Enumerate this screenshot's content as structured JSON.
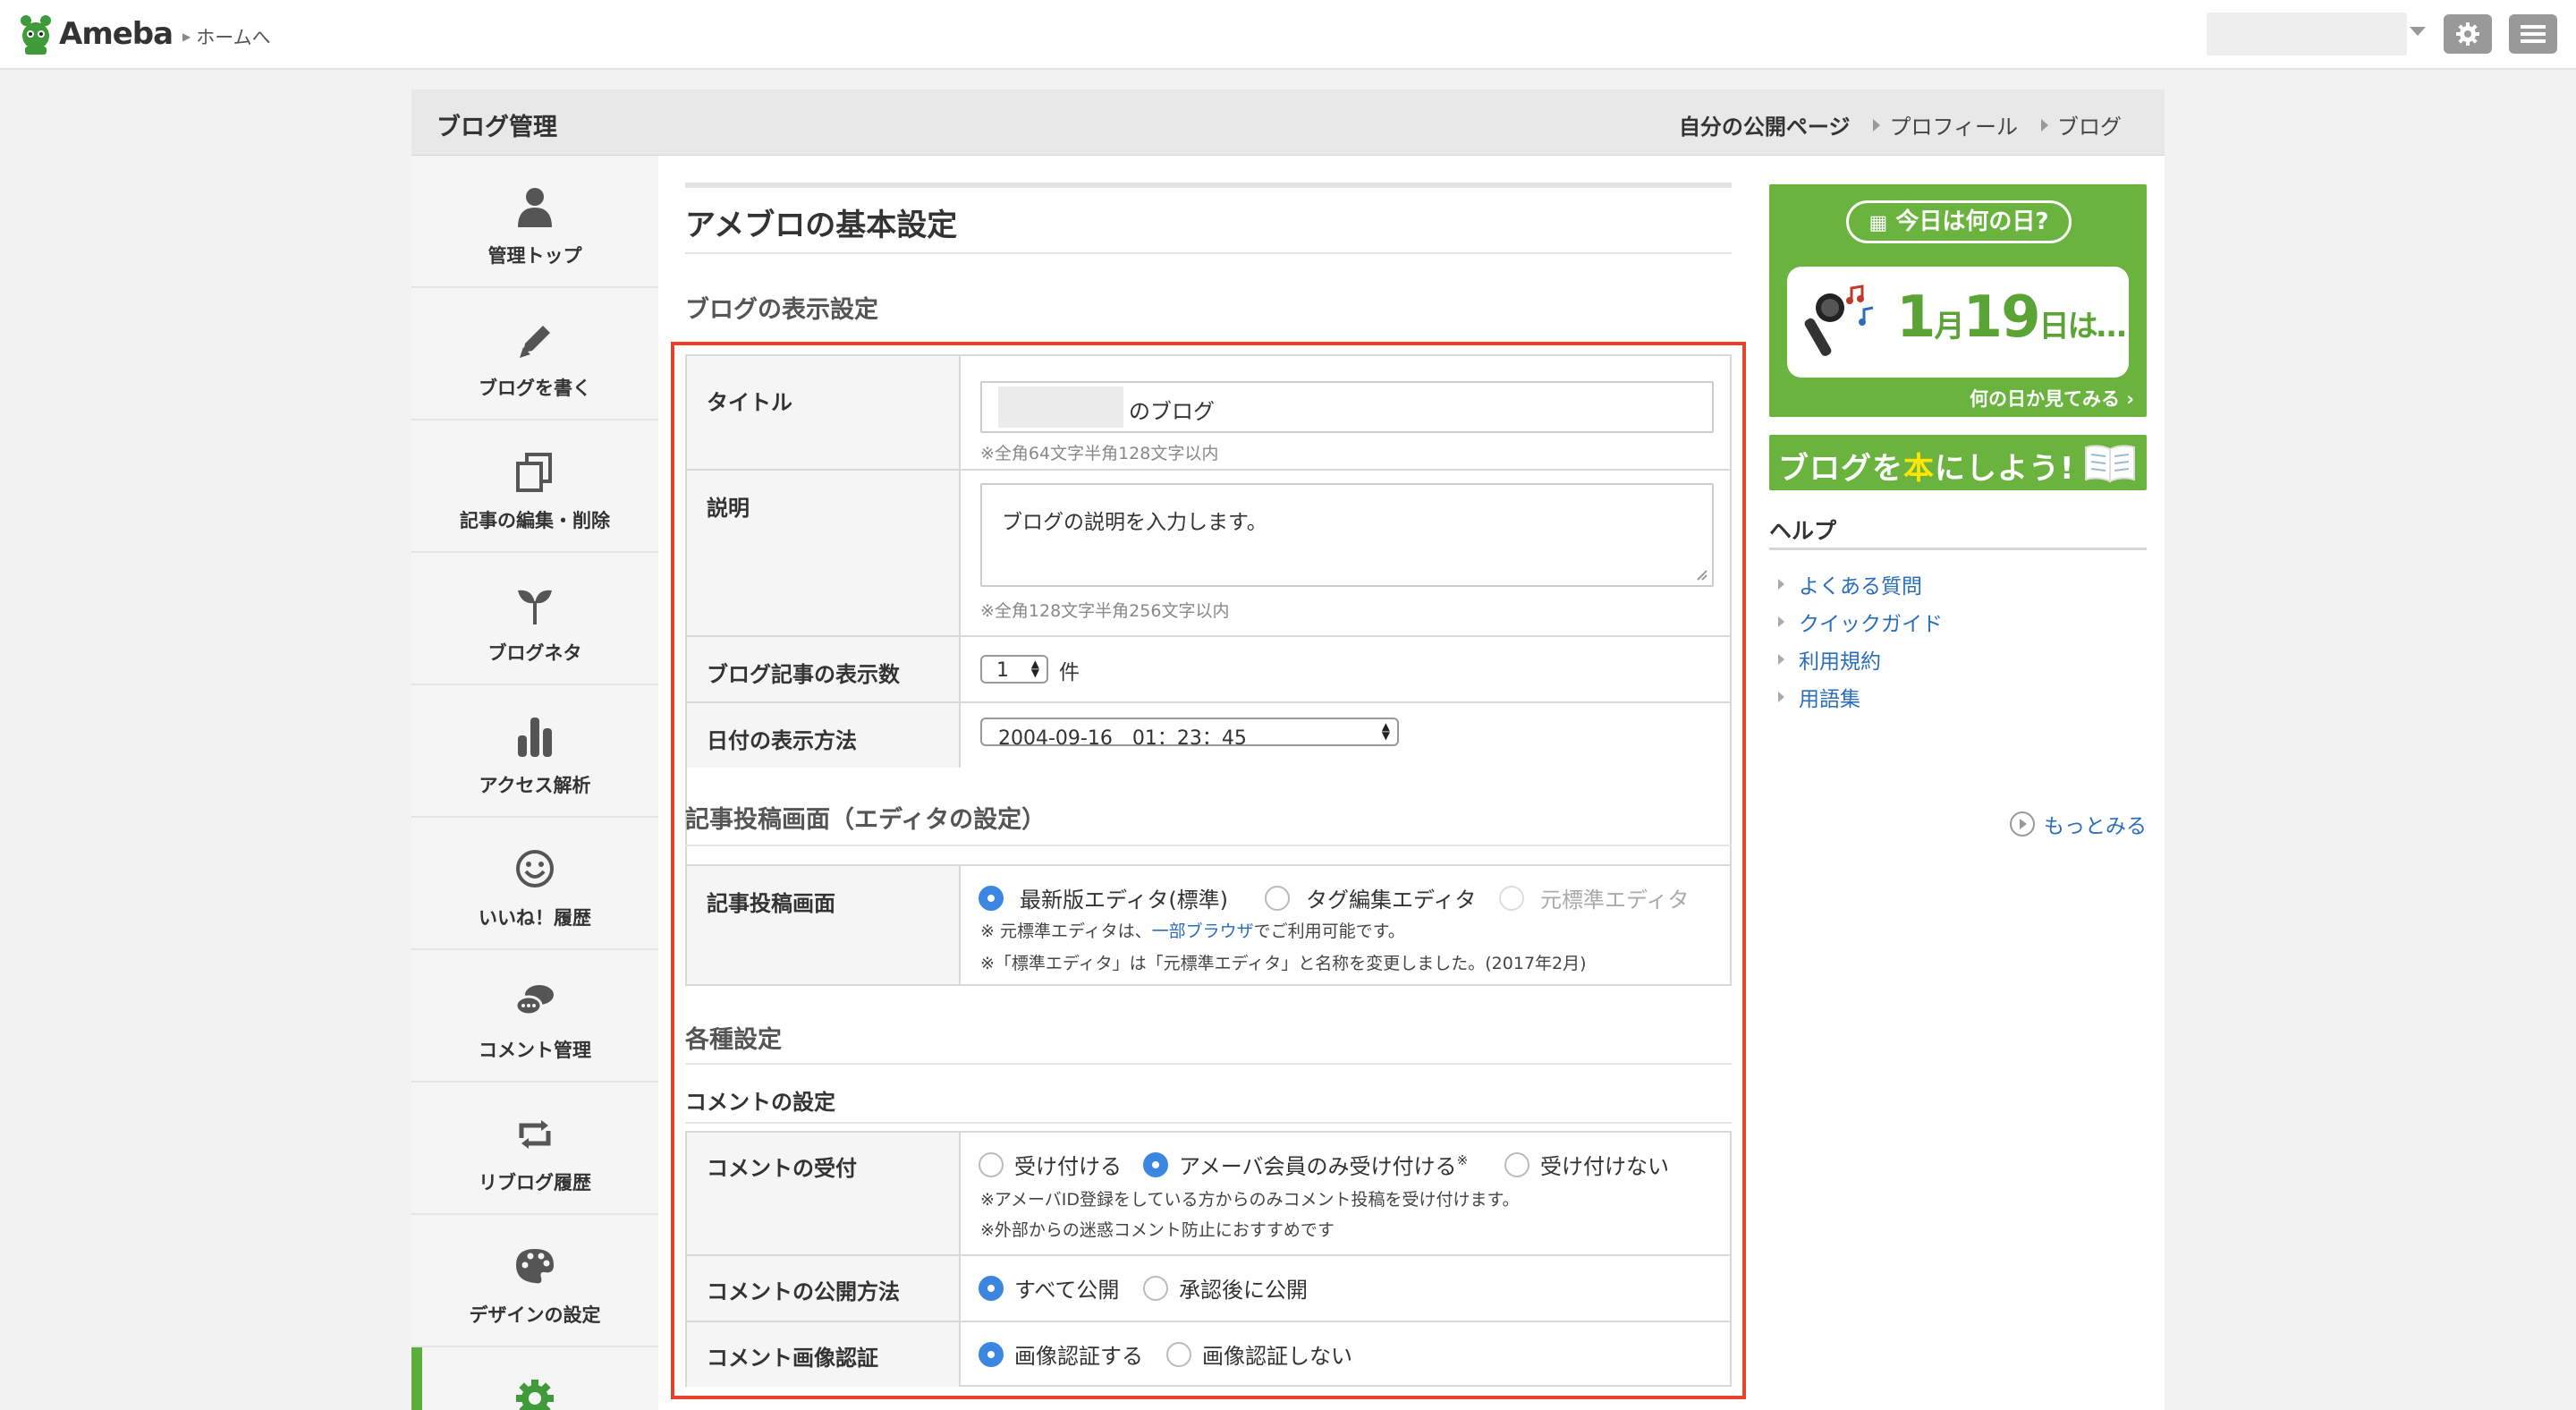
{
  "topbar": {
    "logo": "Ameba",
    "home_link": "ホームへ",
    "icons": [
      "gear-icon",
      "menu-icon"
    ]
  },
  "frame": {
    "title": "ブログ管理",
    "links": [
      "自分の公開ページ",
      "プロフィール",
      "ブログ"
    ]
  },
  "sidebar": {
    "items": [
      {
        "label": "管理トップ",
        "icon": "person-icon"
      },
      {
        "label": "ブログを書く",
        "icon": "pencil-icon"
      },
      {
        "label": "記事の編集・削除",
        "icon": "documents-icon"
      },
      {
        "label": "ブログネタ",
        "icon": "sprout-icon"
      },
      {
        "label": "アクセス解析",
        "icon": "bar-chart-icon"
      },
      {
        "label": "いいね！履歴",
        "icon": "smiley-icon"
      },
      {
        "label": "コメント管理",
        "icon": "speech-bubbles-icon"
      },
      {
        "label": "リブログ履歴",
        "icon": "reblog-icon"
      },
      {
        "label": "デザインの設定",
        "icon": "palette-icon"
      },
      {
        "label": "",
        "icon": "gear-icon"
      }
    ]
  },
  "main": {
    "title": "アメブロの基本設定",
    "display_section": {
      "heading": "ブログの表示設定",
      "title_label": "タイトル",
      "title_value": "のブログ",
      "title_note": "※全角64文字半角128文字以内",
      "desc_label": "説明",
      "desc_placeholder": "ブログの説明を入力します。",
      "desc_note": "※全角128文字半角256文字以内",
      "count_label": "ブログ記事の表示数",
      "count_value": "1",
      "count_unit": "件",
      "date_label": "日付の表示方法",
      "date_value": "2004-09-16　01：23：45"
    },
    "editor_section": {
      "heading": "記事投稿画面（エディタの設定）",
      "label": "記事投稿画面",
      "options": [
        "最新版エディタ(標準)",
        "タグ編集エディタ",
        "元標準エディタ"
      ],
      "selected": 0,
      "note1_pre": "※ 元標準エディタは、",
      "note1_link": "一部ブラウザ",
      "note1_post": "でご利用可能です。",
      "note2": "※「標準エディタ」は「元標準エディタ」と名称を変更しました。(2017年2月)"
    },
    "misc_section": {
      "heading": "各種設定",
      "subheading": "コメントの設定",
      "accept_label": "コメントの受付",
      "accept_options": [
        "受け付ける",
        "アメーバ会員のみ受け付ける",
        "受け付けない"
      ],
      "accept_sup": "※",
      "accept_note1": "※アメーバID登録をしている方からのみコメント投稿を受け付けます。",
      "accept_note2": "※外部からの迷惑コメント防止におすすめです",
      "publish_label": "コメントの公開方法",
      "publish_options": [
        "すべて公開",
        "承認後に公開"
      ],
      "captcha_label": "コメント画像認証",
      "captcha_options": [
        "画像認証する",
        "画像認証しない"
      ]
    }
  },
  "right": {
    "banner1_pill": "今日は何の日?",
    "banner1_month": "1",
    "banner1_month_unit": "月",
    "banner1_day": "19",
    "banner1_day_unit": "日は…",
    "banner1_link": "何の日か見てみる",
    "banner2_pre": "ブログを",
    "banner2_hl": "本",
    "banner2_post": "にしよう!",
    "help_title": "ヘルプ",
    "help_items": [
      "よくある質問",
      "クイックガイド",
      "利用規約",
      "用語集"
    ],
    "more": "もっとみる"
  },
  "colors": {
    "accent_green": "#6bb33f",
    "highlight_red": "#e6442a",
    "radio_blue": "#3a86e0",
    "link_blue": "#2a6ebb"
  }
}
